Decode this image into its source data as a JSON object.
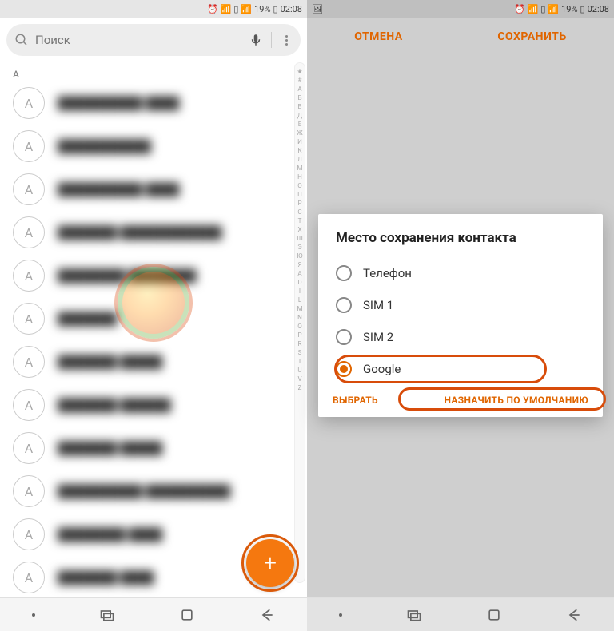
{
  "status": {
    "battery_pct": "19%",
    "time": "02:08"
  },
  "left": {
    "search_placeholder": "Поиск",
    "section_letter": "А",
    "alpha_index": [
      "★",
      "#",
      "А",
      "Б",
      "В",
      "Д",
      "Е",
      "Ж",
      "И",
      "К",
      "Л",
      "М",
      "Н",
      "О",
      "П",
      "Р",
      "С",
      "Т",
      "Х",
      "Ш",
      "Э",
      "Ю",
      "Я",
      "A",
      "D",
      "I",
      "L",
      "M",
      "N",
      "O",
      "P",
      "R",
      "S",
      "T",
      "U",
      "V",
      "Z"
    ],
    "contacts": [
      {
        "initial": "А",
        "name": "██████████ ████"
      },
      {
        "initial": "А",
        "name": "███████████"
      },
      {
        "initial": "А",
        "name": "██████████ ████"
      },
      {
        "initial": "А",
        "name": "███████ ████████████"
      },
      {
        "initial": "А",
        "name": "████████ ████████"
      },
      {
        "initial": "А",
        "name": "███████"
      },
      {
        "initial": "А",
        "name": "███████ █████"
      },
      {
        "initial": "А",
        "name": "███████ ██████"
      },
      {
        "initial": "А",
        "name": "███████ █████"
      },
      {
        "initial": "А",
        "name": "██████████ ██████████"
      },
      {
        "initial": "А",
        "name": "████████ ████"
      },
      {
        "initial": "А",
        "name": "███████ ████"
      }
    ]
  },
  "right": {
    "cancel_label": "ОТМЕНА",
    "save_label": "СОХРАНИТЬ",
    "dialog_title": "Место сохранения контакта",
    "options": [
      {
        "label": "Телефон",
        "selected": false
      },
      {
        "label": "SIM 1",
        "selected": false
      },
      {
        "label": "SIM 2",
        "selected": false
      },
      {
        "label": "Google",
        "selected": true
      }
    ],
    "select_label": "ВЫБРАТЬ",
    "set_default_label": "НАЗНАЧИТЬ ПО УМОЛЧАНИЮ"
  }
}
